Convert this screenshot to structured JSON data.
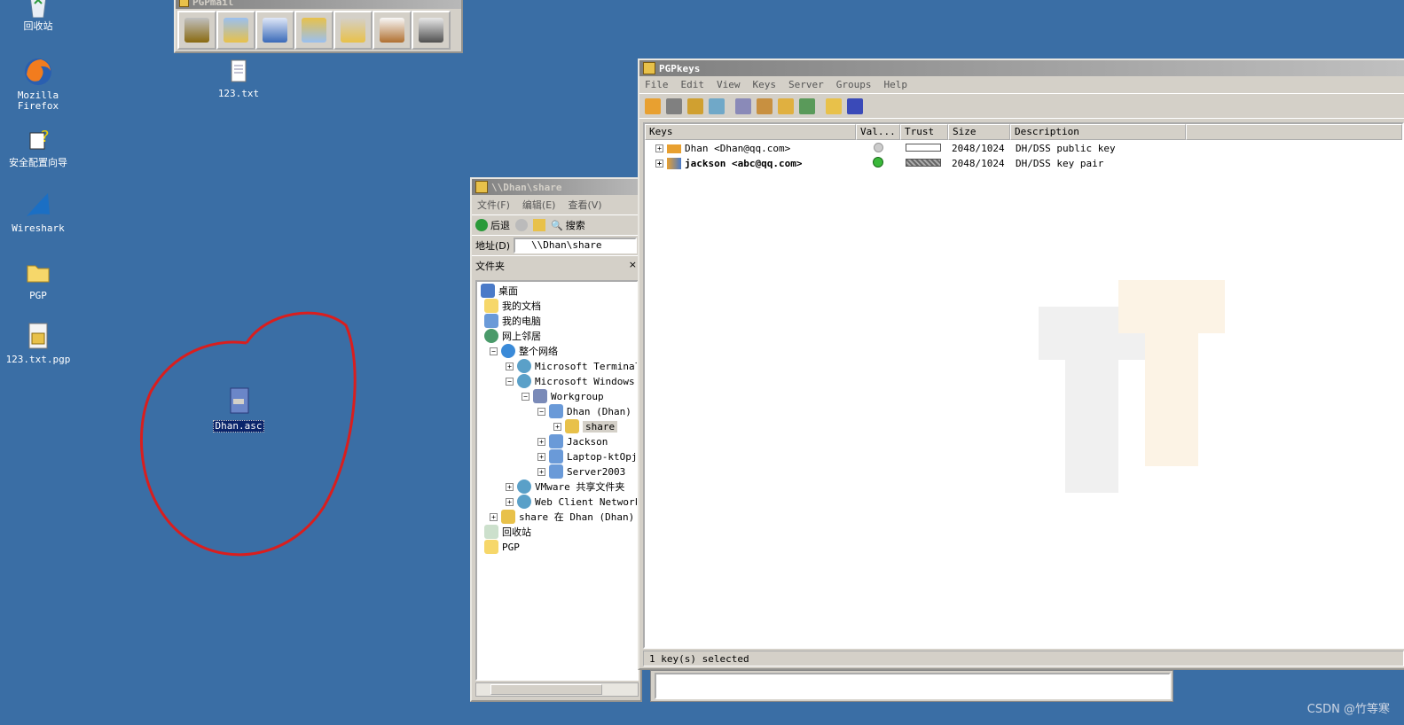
{
  "desktop": {
    "icons": [
      {
        "label": "回收站",
        "icon": "recycle-bin-icon"
      },
      {
        "label": "Mozilla\nFirefox",
        "icon": "firefox-icon"
      },
      {
        "label": "安全配置向导",
        "icon": "security-wizard-icon"
      },
      {
        "label": "Wireshark",
        "icon": "wireshark-icon"
      },
      {
        "label": "PGP",
        "icon": "folder-icon"
      },
      {
        "label": "123.txt.pgp",
        "icon": "pgp-file-icon"
      },
      {
        "label": "123.txt",
        "icon": "text-file-icon"
      },
      {
        "label": "Dhan.asc",
        "icon": "asc-key-file-icon"
      }
    ]
  },
  "pgpmail": {
    "title": "PGPmail"
  },
  "explorer": {
    "title": "\\\\Dhan\\share",
    "menu": [
      "文件(F)",
      "编辑(E)",
      "查看(V)"
    ],
    "back_label": "后退",
    "search_label": "搜索",
    "address_label": "地址(D)",
    "address_value": "\\\\Dhan\\share",
    "folders_label": "文件夹",
    "tree": [
      {
        "label": "桌面"
      },
      {
        "label": "我的文档"
      },
      {
        "label": "我的电脑"
      },
      {
        "label": "网上邻居"
      },
      {
        "label": "整个网络"
      },
      {
        "label": "Microsoft Terminal S"
      },
      {
        "label": "Microsoft Windows Ne"
      },
      {
        "label": "Workgroup"
      },
      {
        "label": "Dhan (Dhan)"
      },
      {
        "label": "share"
      },
      {
        "label": "Jackson"
      },
      {
        "label": "Laptop-ktOpjh"
      },
      {
        "label": "Server2003"
      },
      {
        "label": "VMware 共享文件夹"
      },
      {
        "label": "Web Client Network"
      },
      {
        "label": "share 在 Dhan (Dhan) 上"
      },
      {
        "label": "回收站"
      },
      {
        "label": "PGP"
      }
    ]
  },
  "pgpkeys": {
    "title": "PGPkeys",
    "menu": [
      "File",
      "Edit",
      "View",
      "Keys",
      "Server",
      "Groups",
      "Help"
    ],
    "columns": [
      "Keys",
      "Val...",
      "Trust",
      "Size",
      "Description"
    ],
    "rows": [
      {
        "name": "Dhan <Dhan@qq.com>",
        "size": "2048/1024",
        "description": "DH/DSS public key",
        "trust": 0
      },
      {
        "name": "jackson <abc@qq.com>",
        "size": "2048/1024",
        "description": "DH/DSS key pair",
        "trust": 1
      }
    ],
    "status": "1 key(s) selected"
  },
  "watermark": "CSDN @竹等寒",
  "colors": {
    "desktop": "#3a6ea5",
    "annotation": "#d91e1e"
  }
}
